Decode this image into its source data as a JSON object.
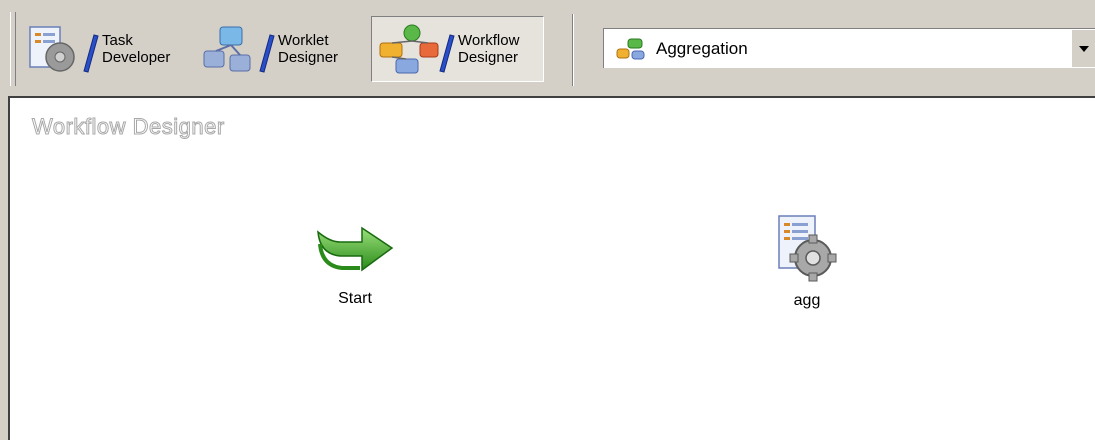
{
  "toolbar": {
    "buttons": [
      {
        "label": "Task\nDeveloper",
        "icon": "task-developer-icon",
        "pressed": false
      },
      {
        "label": "Worklet\nDesigner",
        "icon": "worklet-designer-icon",
        "pressed": false
      },
      {
        "label": "Workflow\nDesigner",
        "icon": "workflow-designer-icon",
        "pressed": true
      }
    ],
    "workflow_select": {
      "value": "Aggregation",
      "icon": "workflow-icon"
    }
  },
  "canvas": {
    "title": "Workflow Designer",
    "tasks": [
      {
        "label": "Start",
        "icon": "start-arrow-icon"
      },
      {
        "label": "agg",
        "icon": "session-gear-icon"
      }
    ]
  },
  "colors": {
    "chrome": "#d4d0c8",
    "canvas": "#ffffff",
    "start_green": "#3aa82a"
  }
}
